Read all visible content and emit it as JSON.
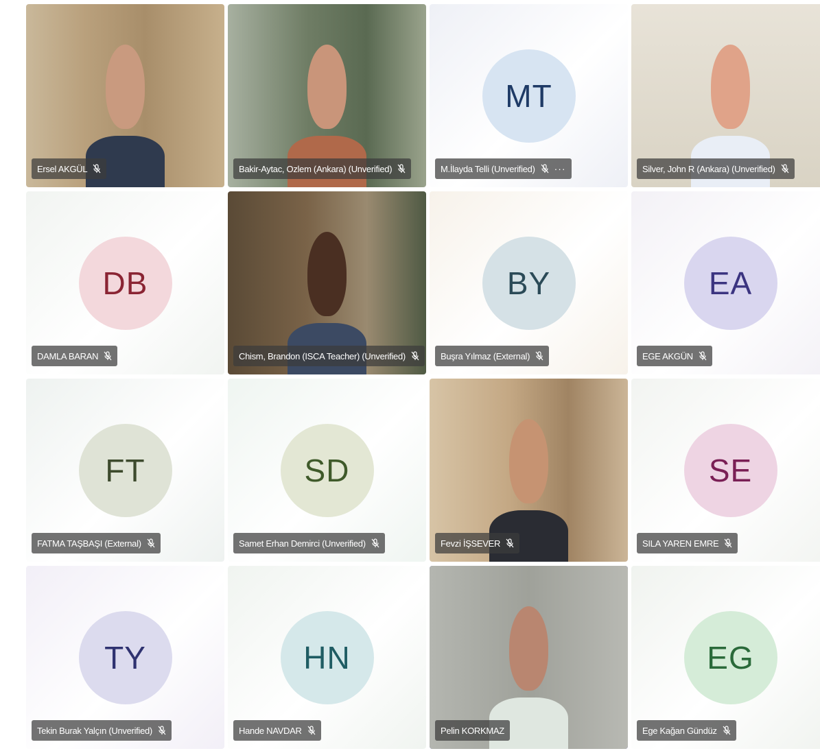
{
  "participants": [
    {
      "name": "Ersel AKGÜL",
      "initials": "",
      "video": true,
      "bg": "#8a7a62",
      "muted": true
    },
    {
      "name": "Bakir-Aytac, Ozlem (Ankara) (Unverified)",
      "initials": "",
      "video": true,
      "bg": "#5f6a55",
      "muted": true
    },
    {
      "name": "M.İlayda Telli (Unverified)",
      "initials": "MT",
      "video": false,
      "bg": "#eef0f6",
      "avatar_bg": "#d7e4f2",
      "avatar_fg": "#1e3a66",
      "muted": true,
      "more": "···"
    },
    {
      "name": "Silver, John R (Ankara) (Unverified)",
      "initials": "",
      "video": true,
      "bg": "#f6f4f1",
      "muted": true
    },
    {
      "name": "DAMLA BARAN",
      "initials": "DB",
      "video": false,
      "bg": "#f1f4f1",
      "avatar_bg": "#f3d8dc",
      "avatar_fg": "#8a2433",
      "muted": true
    },
    {
      "name": "Chism, Brandon (ISCA Teacher) (Unverified)",
      "initials": "",
      "video": true,
      "bg": "#6b5a43",
      "muted": true
    },
    {
      "name": "Buşra Yılmaz (External)",
      "initials": "BY",
      "video": false,
      "bg": "#f7f2ea",
      "avatar_bg": "#d5e1e6",
      "avatar_fg": "#2b4a57",
      "muted": true
    },
    {
      "name": "EGE AKGÜN",
      "initials": "EA",
      "video": false,
      "bg": "#f3f1f6",
      "avatar_bg": "#d9d6ef",
      "avatar_fg": "#3b3480",
      "muted": true
    },
    {
      "name": "FATMA TAŞBAŞI (External)",
      "initials": "FT",
      "video": false,
      "bg": "#eef2f0",
      "avatar_bg": "#dfe3d6",
      "avatar_fg": "#3d4a2d",
      "muted": true
    },
    {
      "name": "Samet Erhan Demirci (Unverified)",
      "initials": "SD",
      "video": false,
      "bg": "#eff5f1",
      "avatar_bg": "#e3e7d4",
      "avatar_fg": "#3f5a2a",
      "muted": true
    },
    {
      "name": "Fevzi İŞSEVER",
      "initials": "",
      "video": true,
      "bg": "#8f7558",
      "muted": true
    },
    {
      "name": "SILA YAREN EMRE",
      "initials": "SE",
      "video": false,
      "bg": "#f2f4f1",
      "avatar_bg": "#eed4e3",
      "avatar_fg": "#7a1f55",
      "muted": true
    },
    {
      "name": "Tekin Burak Yalçın (Unverified)",
      "initials": "TY",
      "video": false,
      "bg": "#f2eff7",
      "avatar_bg": "#dcdbee",
      "avatar_fg": "#2f3270",
      "muted": true
    },
    {
      "name": "Hande NAVDAR",
      "initials": "HN",
      "video": false,
      "bg": "#f0f4f0",
      "avatar_bg": "#d5e8ea",
      "avatar_fg": "#1f5c63",
      "muted": true
    },
    {
      "name": "Pelin KORKMAZ",
      "initials": "",
      "video": true,
      "bg": "#a7a8a2",
      "muted": false,
      "active": true
    },
    {
      "name": "Ege Kağan Gündüz",
      "initials": "EG",
      "video": false,
      "bg": "#f0f3ef",
      "avatar_bg": "#d5ecd8",
      "avatar_fg": "#2a6a3a",
      "muted": true
    }
  ]
}
